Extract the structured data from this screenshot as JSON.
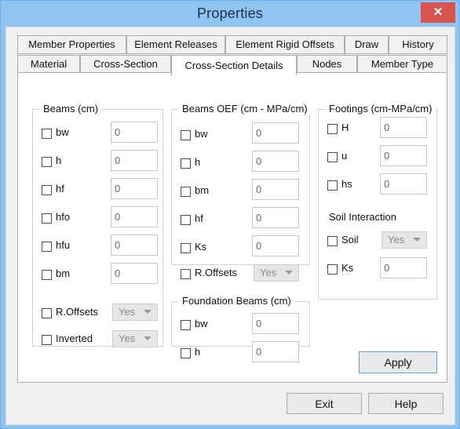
{
  "window": {
    "title": "Properties",
    "close_label": "✕",
    "titlebar_color": "#8FC4F0",
    "close_color": "#D9534F"
  },
  "tabs": {
    "row1": [
      {
        "label": "Member Properties",
        "selected": false
      },
      {
        "label": "Element Releases",
        "selected": false
      },
      {
        "label": "Element Rigid Offsets",
        "selected": false
      },
      {
        "label": "Draw",
        "selected": false
      },
      {
        "label": "History",
        "selected": false
      }
    ],
    "row2": [
      {
        "label": "Material",
        "selected": false
      },
      {
        "label": "Cross-Section",
        "selected": false
      },
      {
        "label": "Cross-Section Details",
        "selected": true
      },
      {
        "label": "Nodes",
        "selected": false
      },
      {
        "label": "Member Type",
        "selected": false
      }
    ]
  },
  "groups": {
    "beams": {
      "title": "Beams (cm)",
      "fields": [
        {
          "label": "bw",
          "value": "0",
          "checked": false
        },
        {
          "label": "h",
          "value": "0",
          "checked": false
        },
        {
          "label": "hf",
          "value": "0",
          "checked": false
        },
        {
          "label": "hfo",
          "value": "0",
          "checked": false
        },
        {
          "label": "hfu",
          "value": "0",
          "checked": false
        },
        {
          "label": "bm",
          "value": "0",
          "checked": false
        }
      ],
      "combos": [
        {
          "label": "R.Offsets",
          "value": "Yes",
          "checked": false
        },
        {
          "label": "Inverted",
          "value": "Yes",
          "checked": false
        }
      ]
    },
    "beams_oef": {
      "title": "Beams OEF (cm - MPa/cm)",
      "fields": [
        {
          "label": "bw",
          "value": "0",
          "checked": false
        },
        {
          "label": "h",
          "value": "0",
          "checked": false
        },
        {
          "label": "bm",
          "value": "0",
          "checked": false
        },
        {
          "label": "hf",
          "value": "0",
          "checked": false
        },
        {
          "label": "Ks",
          "value": "0",
          "checked": false
        }
      ],
      "combos": [
        {
          "label": "R.Offsets",
          "value": "Yes",
          "checked": false
        }
      ]
    },
    "foundation_beams": {
      "title": "Foundation Beams (cm)",
      "fields": [
        {
          "label": "bw",
          "value": "0",
          "checked": false
        },
        {
          "label": "h",
          "value": "0",
          "checked": false
        }
      ]
    },
    "footings": {
      "title": "Footings (cm-MPa/cm)",
      "fields": [
        {
          "label": "H",
          "value": "0",
          "checked": false
        },
        {
          "label": "u",
          "value": "0",
          "checked": false
        },
        {
          "label": "hs",
          "value": "0",
          "checked": false
        }
      ],
      "soil_section_label": "Soil Interaction",
      "soil_combo": {
        "label": "Soil",
        "value": "Yes",
        "checked": false
      },
      "soil_ks": {
        "label": "Ks",
        "value": "0",
        "checked": false
      }
    }
  },
  "buttons": {
    "apply": "Apply",
    "exit": "Exit",
    "help": "Help"
  }
}
